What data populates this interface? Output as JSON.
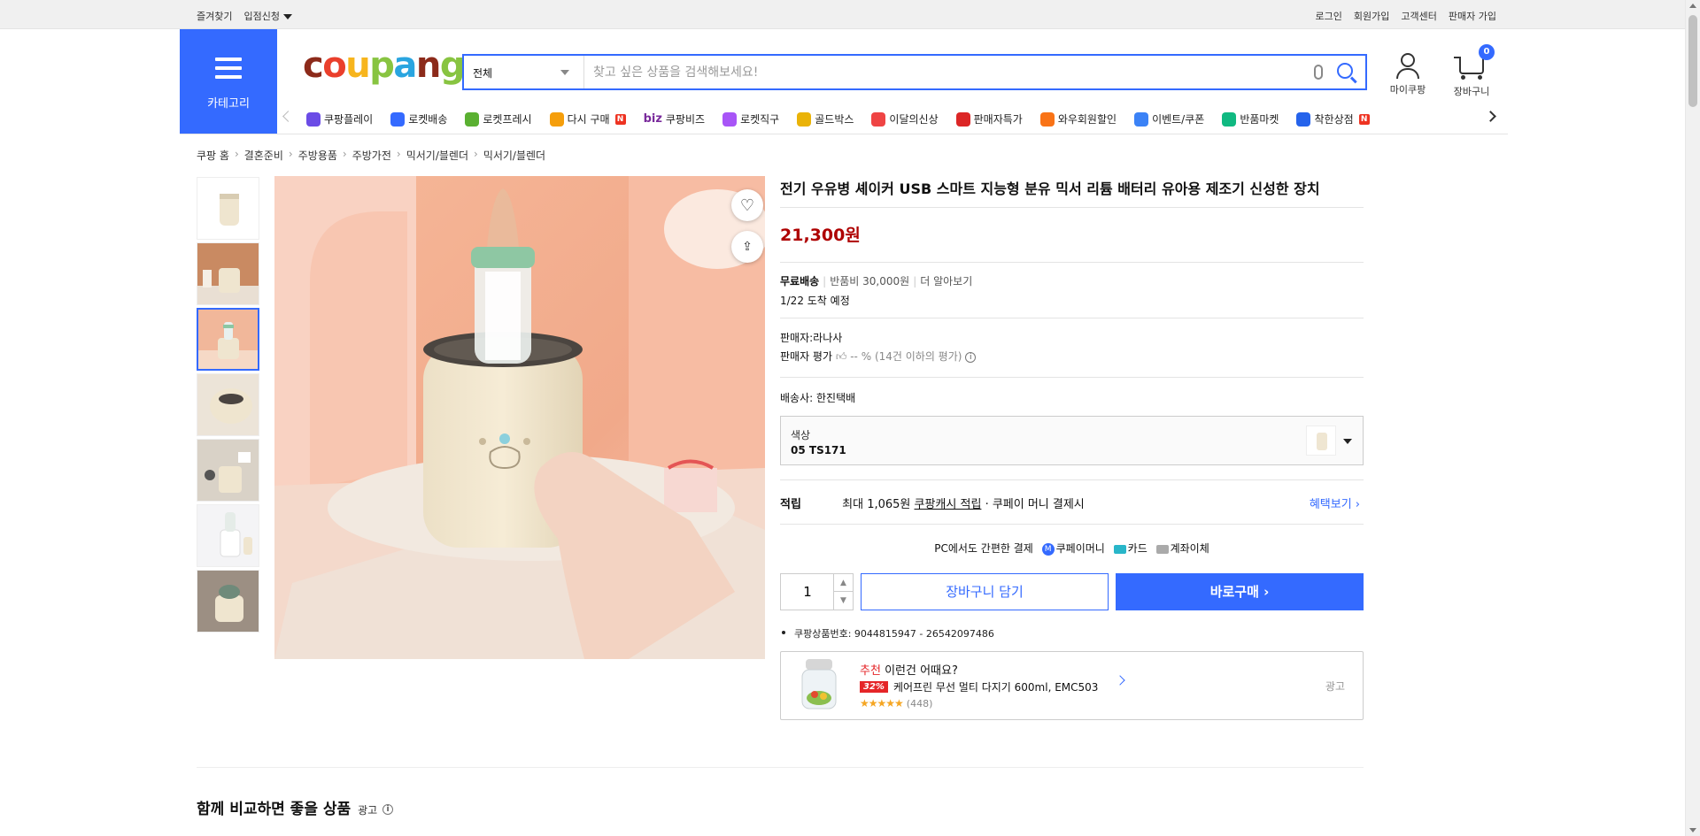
{
  "topbar": {
    "left": [
      "즐겨찾기",
      "입점신청"
    ],
    "right": [
      "로그인",
      "회원가입",
      "고객센터",
      "판매자 가입"
    ]
  },
  "header": {
    "category_label": "카테고리",
    "logo_text": [
      "cou",
      "pa",
      "ng"
    ],
    "search": {
      "scope": "전체",
      "placeholder": "찾고 싶은 상품을 검색해보세요!"
    },
    "mycoupang_label": "마이쿠팡",
    "cart_label": "장바구니",
    "cart_count": "0"
  },
  "nav": {
    "items": [
      {
        "label": "쿠팡플레이",
        "icon": "play-icon",
        "color": "#6b4ce6"
      },
      {
        "label": "로켓배송",
        "icon": "rocket-icon",
        "color": "#346aff"
      },
      {
        "label": "로켓프레시",
        "icon": "rocket-fresh-icon",
        "color": "#5ab031"
      },
      {
        "label": "다시 구매",
        "icon": "rebuy-icon",
        "color": "#f59e0b",
        "badge": "N"
      },
      {
        "label": "쿠팡비즈",
        "icon": "biz-icon",
        "prefix": "biz"
      },
      {
        "label": "로켓직구",
        "icon": "global-icon",
        "color": "#a855f7"
      },
      {
        "label": "골드박스",
        "icon": "goldbox-icon",
        "color": "#eab308"
      },
      {
        "label": "이달의신상",
        "icon": "new-icon",
        "color": "#ef4444"
      },
      {
        "label": "판매자특가",
        "icon": "percent-icon",
        "color": "#dc2626"
      },
      {
        "label": "와우회원할인",
        "icon": "wow-icon",
        "color": "#f97316"
      },
      {
        "label": "이벤트/쿠폰",
        "icon": "coupon-icon",
        "color": "#3b82f6"
      },
      {
        "label": "반품마켓",
        "icon": "return-market-icon",
        "color": "#10b981"
      },
      {
        "label": "착한상점",
        "icon": "good-store-icon",
        "color": "#2563eb",
        "badge": "N"
      }
    ]
  },
  "breadcrumb": [
    "쿠팡 홈",
    "결혼준비",
    "주방용품",
    "주방가전",
    "믹서기/블렌더",
    "믹서기/블렌더"
  ],
  "product": {
    "title": "전기 우유병 셰이커 USB 스마트 지능형 분유 믹서 리튬 배터리 유아용 제조기 신성한 장치",
    "price": "21,300원",
    "shipping": {
      "free": "무료배송",
      "return_fee": "반품비 30,000원",
      "more": "더 알아보기",
      "arrival": "1/22 도착 예정"
    },
    "seller": {
      "name_label": "판매자:",
      "name": "라나사",
      "rating_label": "판매자 평가",
      "rating_value": "-- %",
      "rating_note": "(14건 이하의 평가)"
    },
    "carrier_label": "배송사:",
    "carrier": "한진택배",
    "option": {
      "label": "색상",
      "value": "05 TS171"
    },
    "reward": {
      "key": "적립",
      "text1": "최대 1,065원",
      "link": "쿠팡캐시 적립",
      "text2": "· 쿠페이 머니 결제시",
      "benefit": "혜택보기 ›"
    },
    "pay": {
      "lead": "PC에서도 간편한 결제",
      "methods": [
        "쿠페이머니",
        "카드",
        "계좌이체"
      ]
    },
    "quantity": "1",
    "cart_button": "장바구니 담기",
    "buy_button": "바로구매 ›",
    "product_number": "쿠팡상품번호: 9044815947 - 26542097486"
  },
  "recommend": {
    "title_red": "추천",
    "title": "이런건 어때요?",
    "discount": "32%",
    "name": "케어프린 무선 멀티 다지기 600ml, EMC503",
    "stars": "★★★★★",
    "reviews": "(448)",
    "ad": "광고"
  },
  "compare": {
    "title": "함께 비교하면 좋을 상품",
    "ad": "광고"
  },
  "colors": {
    "accent": "#346aff",
    "price": "#ae0000",
    "reco_red": "#e52528"
  }
}
